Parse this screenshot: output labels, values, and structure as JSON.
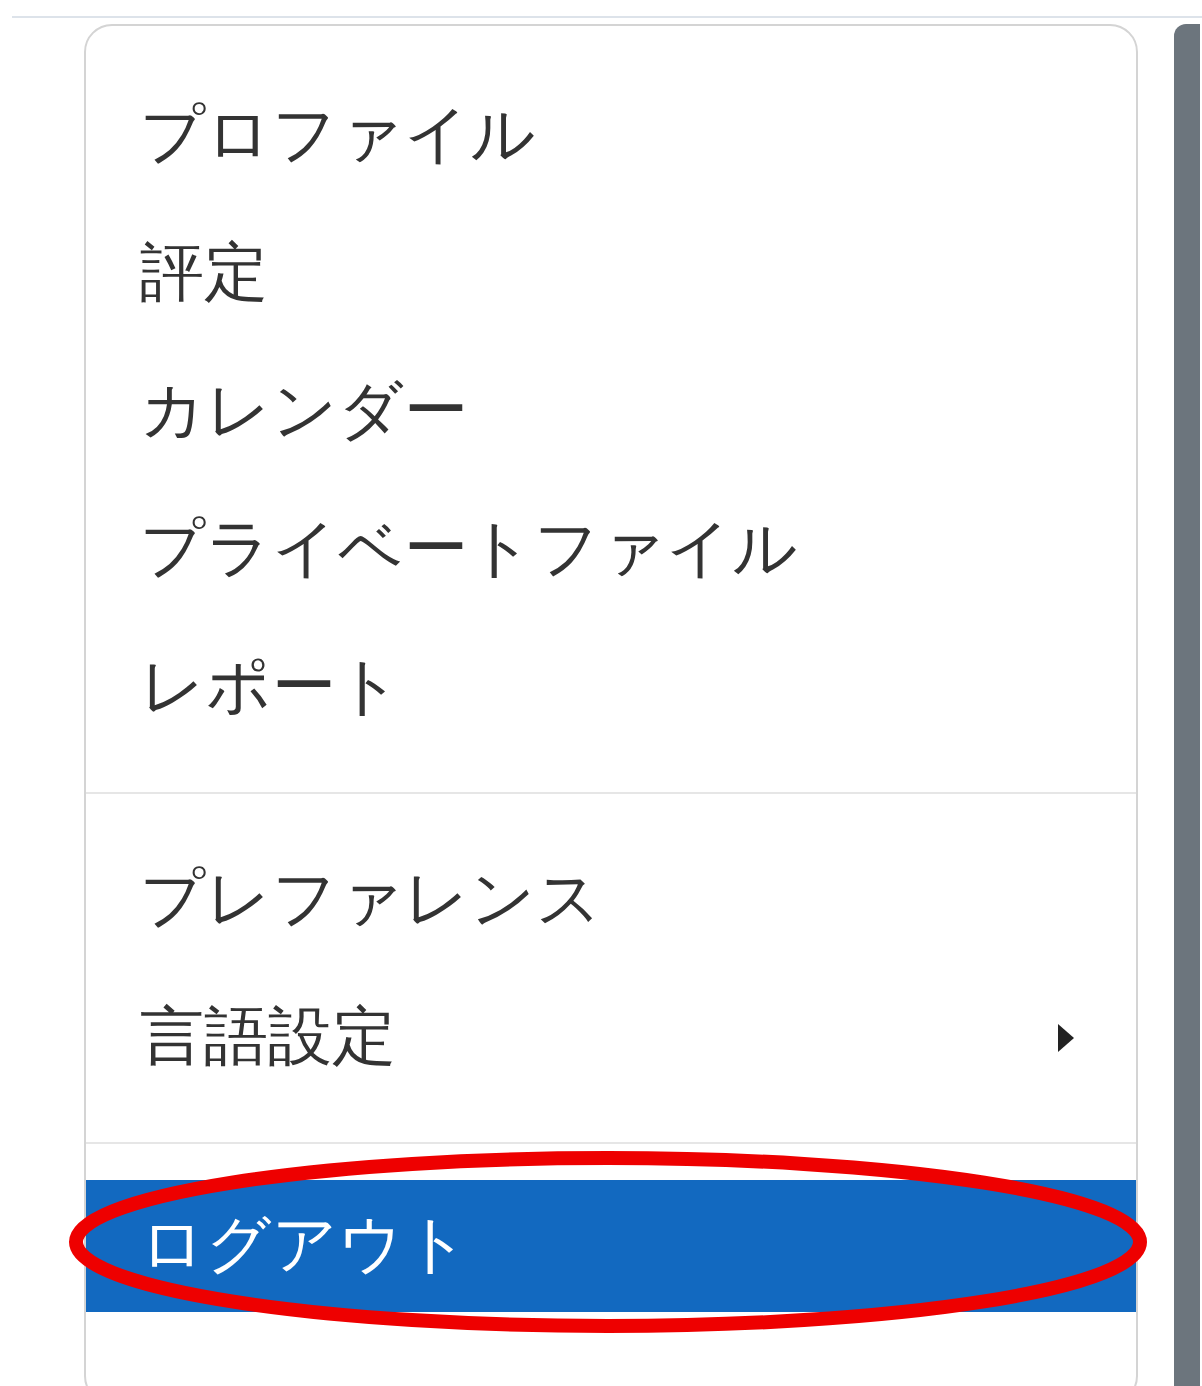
{
  "menu": {
    "sections": [
      {
        "items": [
          {
            "label": "プロファイル",
            "selected": false,
            "submenu": false
          },
          {
            "label": "評定",
            "selected": false,
            "submenu": false
          },
          {
            "label": "カレンダー",
            "selected": false,
            "submenu": false
          },
          {
            "label": "プライベートファイル",
            "selected": false,
            "submenu": false
          },
          {
            "label": "レポート",
            "selected": false,
            "submenu": false
          }
        ]
      },
      {
        "items": [
          {
            "label": "プレファレンス",
            "selected": false,
            "submenu": false
          },
          {
            "label": "言語設定",
            "selected": false,
            "submenu": true
          }
        ]
      },
      {
        "items": [
          {
            "label": "ログアウト",
            "selected": true,
            "submenu": false,
            "circled": true
          }
        ]
      }
    ]
  }
}
